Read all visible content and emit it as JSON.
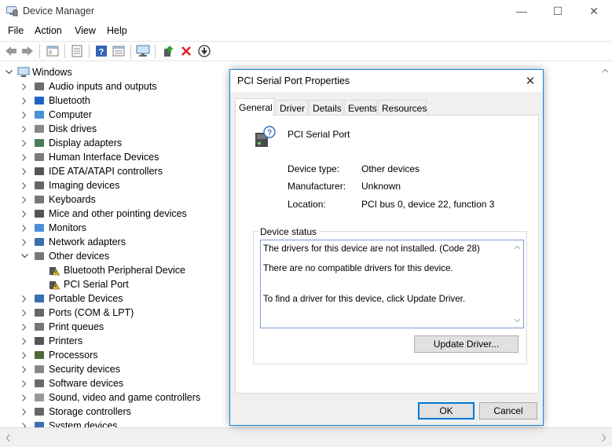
{
  "window": {
    "title": "Device Manager",
    "controls": {
      "minimize": "—",
      "maximize": "☐",
      "close": "✕"
    }
  },
  "menu": [
    "File",
    "Action",
    "View",
    "Help"
  ],
  "toolbar_icons": [
    "back-icon",
    "forward-icon",
    "show-hide-icon",
    "properties-icon",
    "help-icon",
    "view-icon",
    "monitor-icon",
    "update-driver-icon",
    "uninstall-icon",
    "scan-icon"
  ],
  "tree": {
    "root": "Windows",
    "items": [
      "Audio inputs and outputs",
      "Bluetooth",
      "Computer",
      "Disk drives",
      "Display adapters",
      "Human Interface Devices",
      "IDE ATA/ATAPI controllers",
      "Imaging devices",
      "Keyboards",
      "Mice and other pointing devices",
      "Monitors",
      "Network adapters",
      "Other devices",
      "Portable Devices",
      "Ports (COM & LPT)",
      "Print queues",
      "Printers",
      "Processors",
      "Security devices",
      "Software devices",
      "Sound, video and game controllers",
      "Storage controllers",
      "System devices"
    ],
    "other_devices_children": [
      "Bluetooth Peripheral Device",
      "PCI Serial Port"
    ]
  },
  "dialog": {
    "title": "PCI Serial Port Properties",
    "tabs": [
      "General",
      "Driver",
      "Details",
      "Events",
      "Resources"
    ],
    "device_name": "PCI Serial Port",
    "props": [
      {
        "label": "Device type:",
        "value": "Other devices"
      },
      {
        "label": "Manufacturer:",
        "value": "Unknown"
      },
      {
        "label": "Location:",
        "value": "PCI bus 0, device 22, function 3"
      }
    ],
    "status_group_label": "Device status",
    "status_lines": [
      "The drivers for this device are not installed. (Code 28)",
      "There are no compatible drivers for this device.",
      "To find a driver for this device, click Update Driver."
    ],
    "update_driver_label": "Update Driver...",
    "ok_label": "OK",
    "cancel_label": "Cancel"
  },
  "colors": {
    "accent": "#0078d7",
    "dialog_border": "#1883d7",
    "warning": "#f5c518"
  }
}
